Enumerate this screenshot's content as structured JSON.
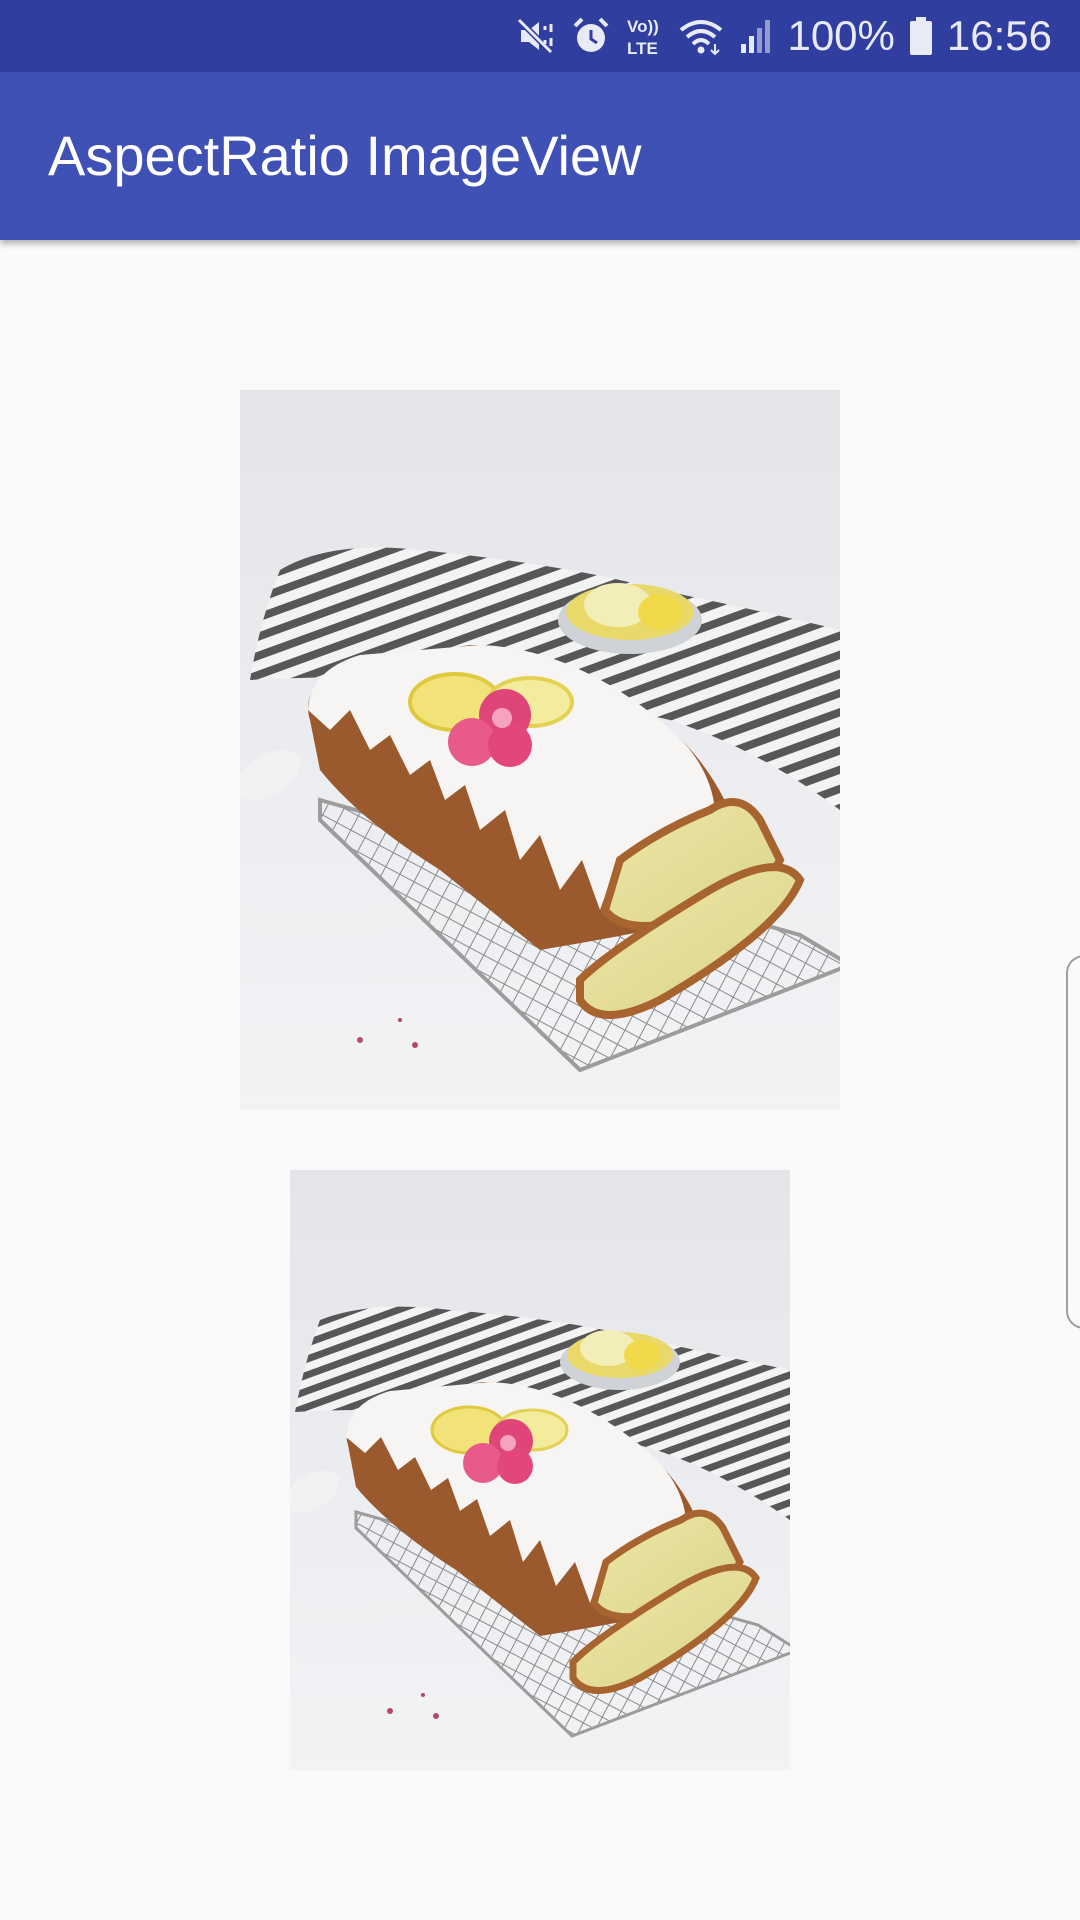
{
  "status_bar": {
    "battery": "100%",
    "time": "16:56",
    "icons": [
      "mute-vibrate-icon",
      "alarm-icon",
      "volte-icon",
      "wifi-icon",
      "signal-icon",
      "battery-icon"
    ],
    "volte_label_top": "Vo))",
    "volte_label_bottom": "LTE"
  },
  "app_bar": {
    "title": "AspectRatio ImageView"
  },
  "colors": {
    "status_bar": "#303f9f",
    "app_bar": "#3f51b5",
    "background": "#fafafa"
  },
  "images": [
    {
      "description_icon": "lemon-loaf-cake-photo"
    },
    {
      "description_icon": "lemon-loaf-cake-photo"
    }
  ]
}
